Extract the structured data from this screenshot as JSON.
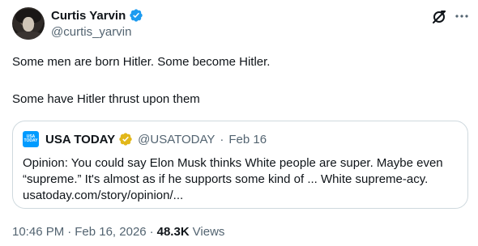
{
  "author": {
    "display_name": "Curtis Yarvin",
    "handle": "@curtis_yarvin",
    "verified_color": "#1d9bf0"
  },
  "header_icons": [
    "grok-icon",
    "more-icon"
  ],
  "tweet": {
    "lines": [
      "Some men are born Hitler. Some become Hitler.",
      "Some have Hitler thrust upon them"
    ]
  },
  "quote": {
    "logo_text": [
      "USA",
      "TODAY"
    ],
    "display_name": "USA TODAY",
    "handle": "@USATODAY",
    "separator": "·",
    "date": "Feb 16",
    "verified_color": "#e2b719",
    "body_lines": [
      "Opinion: You could say Elon Musk thinks White people are super. Maybe even",
      "“supreme.” It's almost as if he supports some kind of ... White supreme-acy.",
      "usatoday.com/story/opinion/..."
    ]
  },
  "meta": {
    "time": "10:46 PM",
    "separator": "·",
    "date": "Feb 16, 2026",
    "views_count": "48.3K",
    "views_label": "Views"
  }
}
